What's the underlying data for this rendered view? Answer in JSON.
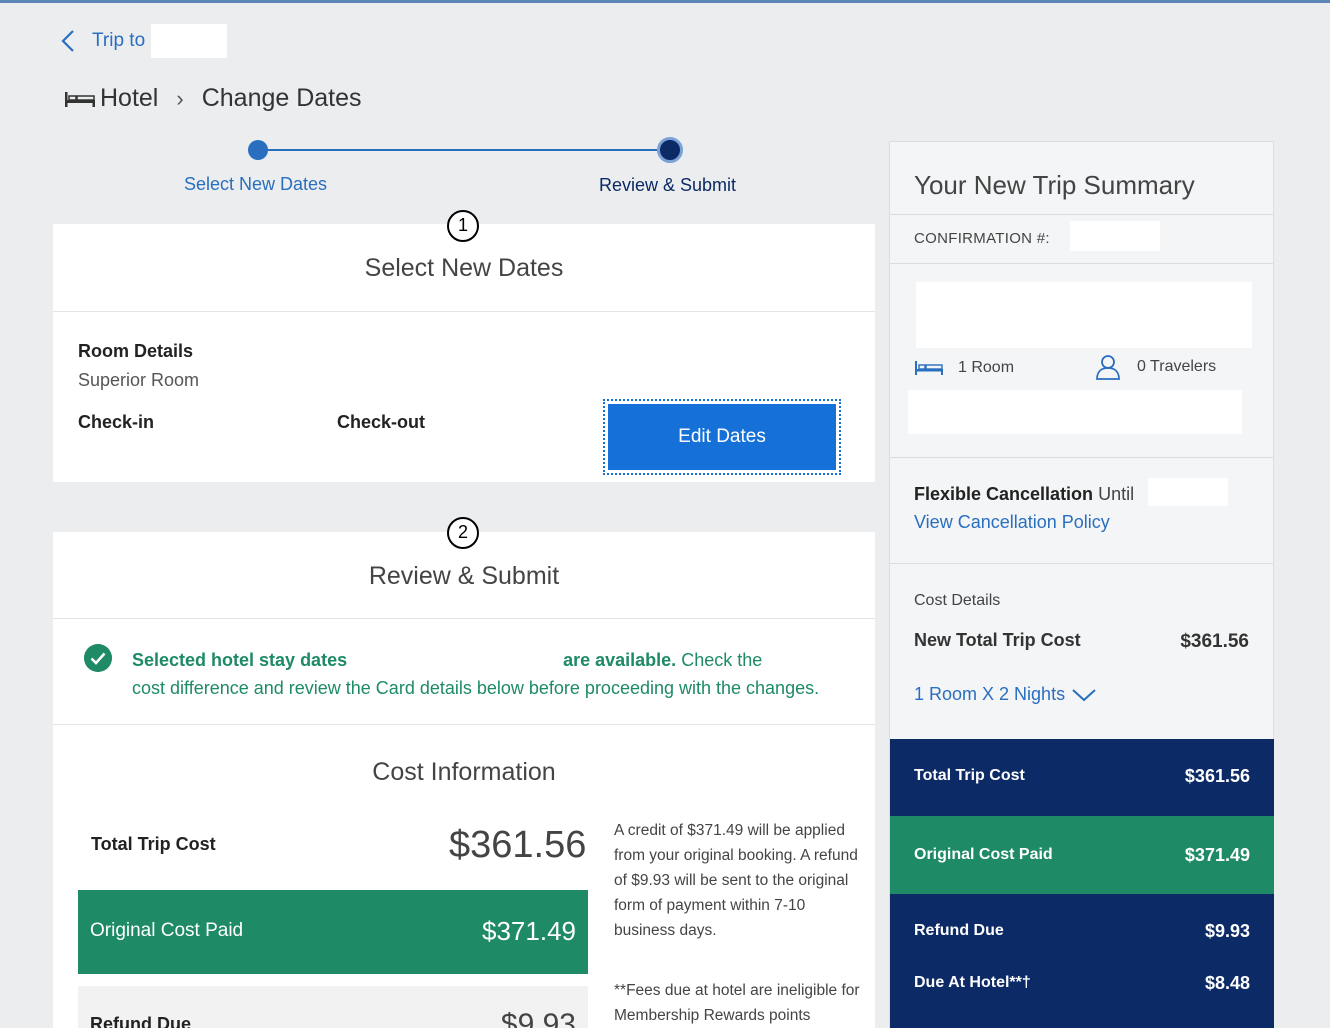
{
  "nav": {
    "back_label": "Trip to"
  },
  "breadcrumb": {
    "section": "Hotel",
    "separator": "›",
    "page": "Change Dates"
  },
  "stepper": {
    "step1": "Select New Dates",
    "step2": "Review & Submit"
  },
  "select_dates": {
    "step_number": "1",
    "title": "Select New Dates",
    "room_details_label": "Room Details",
    "room_type": "Superior Room",
    "checkin_label": "Check-in",
    "checkout_label": "Check-out",
    "edit_button": "Edit Dates"
  },
  "review": {
    "step_number": "2",
    "title": "Review & Submit",
    "avail_bold_1": "Selected hotel stay dates",
    "avail_bold_2": "are available.",
    "avail_text_1": " Check the",
    "avail_text_2": "cost difference and review the Card details below before proceeding with the changes.",
    "cost_title": "Cost Information",
    "total_trip_cost_label": "Total Trip Cost",
    "total_trip_cost_value": "$361.56",
    "original_cost_label": "Original Cost Paid",
    "original_cost_value": "$371.49",
    "refund_label": "Refund Due",
    "refund_value": "$9.93",
    "credit_note": "A credit of $371.49 will be applied from your original booking. A refund of $9.93 will be sent to the original form of payment within 7-10 business days.",
    "fees_note": "**Fees due at hotel are ineligible for Membership Rewards points"
  },
  "summary": {
    "title": "Your New Trip Summary",
    "confirmation_label": "CONFIRMATION #:",
    "rooms": "1 Room",
    "travelers": "0 Travelers",
    "flex_bold": "Flexible Cancellation",
    "flex_until": " Until",
    "policy_link": "View Cancellation Policy",
    "cost_details": "Cost Details",
    "new_total_label": "New Total Trip Cost",
    "new_total_value": "$361.56",
    "nights_link": "1 Room X 2 Nights",
    "total_trip_cost_label": "Total Trip Cost",
    "total_trip_cost_value": "$361.56",
    "original_cost_label": "Original Cost Paid",
    "original_cost_value": "$371.49",
    "refund_label": "Refund Due",
    "refund_value": "$9.93",
    "due_hotel_label": "Due At Hotel**†",
    "due_hotel_value": "$8.48"
  },
  "colors": {
    "link_blue": "#2a6ebf",
    "button_blue": "#1570d8",
    "navy": "#0c2a66",
    "green": "#1e8a66",
    "background": "#ebedef"
  },
  "icons": [
    "chevron-left-icon",
    "bed-icon",
    "check-circle-icon",
    "person-icon",
    "chevron-down-icon"
  ]
}
